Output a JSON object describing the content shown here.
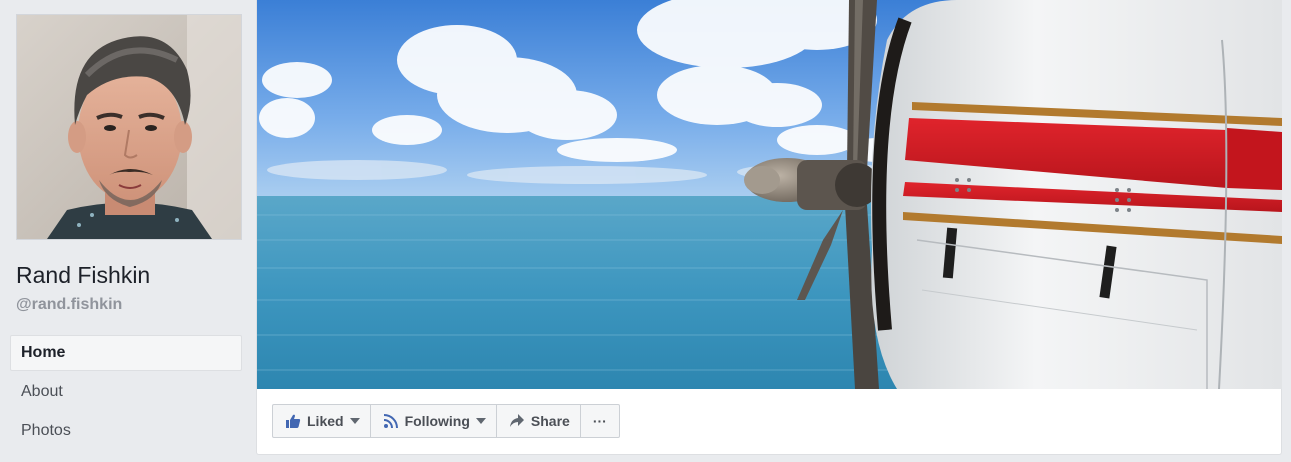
{
  "profile": {
    "name": "Rand Fishkin",
    "handle": "@rand.fishkin"
  },
  "nav": {
    "items": [
      {
        "label": "Home",
        "active": true
      },
      {
        "label": "About",
        "active": false
      },
      {
        "label": "Photos",
        "active": false
      }
    ]
  },
  "actions": {
    "liked_label": "Liked",
    "following_label": "Following",
    "share_label": "Share",
    "more_label": "···"
  },
  "icons": {
    "liked": "thumbs-up-icon",
    "following": "rss-feed-icon",
    "share": "share-arrow-icon",
    "caret": "caret-down-icon"
  },
  "colors": {
    "page_background": "#e9ebee",
    "liked_icon": "#4267b2",
    "text": "#4b4f56",
    "handle": "#90949c"
  }
}
